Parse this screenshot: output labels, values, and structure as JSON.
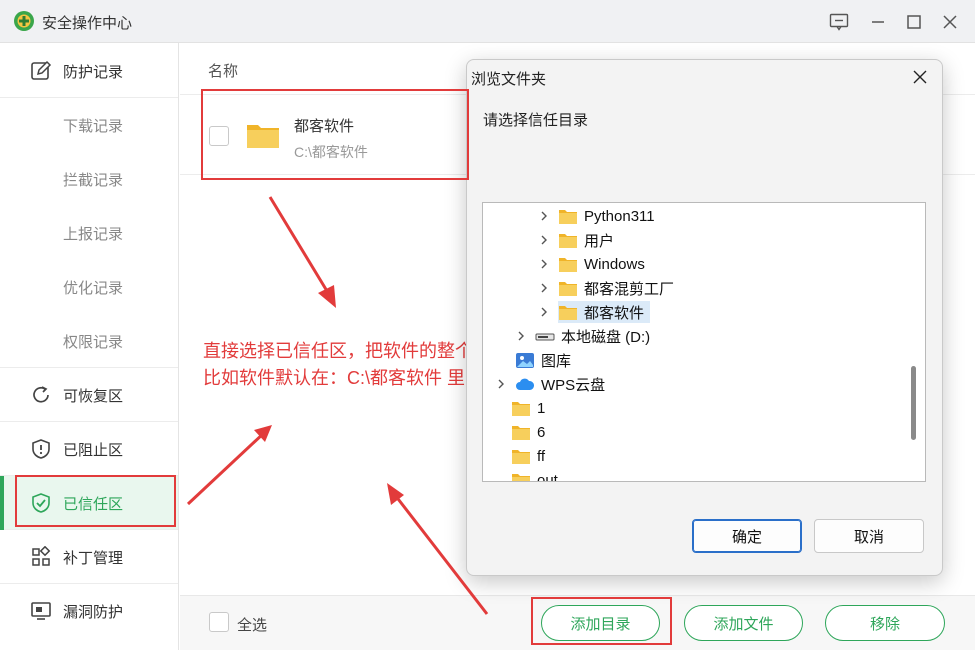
{
  "app": {
    "title": "安全操作中心"
  },
  "sidebar": {
    "items": [
      {
        "label": "防护记录",
        "icon": "edit-icon",
        "type": "main"
      },
      {
        "label": "下载记录",
        "type": "sub"
      },
      {
        "label": "拦截记录",
        "type": "sub"
      },
      {
        "label": "上报记录",
        "type": "sub"
      },
      {
        "label": "优化记录",
        "type": "sub"
      },
      {
        "label": "权限记录",
        "type": "sub"
      },
      {
        "label": "可恢复区",
        "icon": "restore-icon",
        "type": "main"
      },
      {
        "label": "已阻止区",
        "icon": "shield-alert-icon",
        "type": "main"
      },
      {
        "label": "已信任区",
        "icon": "shield-check-icon",
        "type": "main",
        "active": true
      },
      {
        "label": "补丁管理",
        "icon": "grid-icon",
        "type": "main"
      },
      {
        "label": "漏洞防护",
        "icon": "monitor-icon",
        "type": "main"
      }
    ]
  },
  "main": {
    "column_header": "名称",
    "rows": [
      {
        "name": "都客软件",
        "path": "C:\\都客软件"
      }
    ]
  },
  "footer": {
    "select_all": "全选",
    "add_dir": "添加目录",
    "add_file": "添加文件",
    "remove": "移除"
  },
  "annotation": {
    "line1": "直接选择已信任区，把软件的整个目录添加进去。",
    "line2": "比如软件默认在：C:\\都客软件 里面"
  },
  "dialog": {
    "title": "浏览文件夹",
    "prompt": "请选择信任目录",
    "tree": [
      {
        "label": "Python311",
        "icon": "folder-icon",
        "expandable": true
      },
      {
        "label": "用户",
        "icon": "folder-icon",
        "expandable": true
      },
      {
        "label": "Windows",
        "icon": "folder-icon",
        "expandable": true
      },
      {
        "label": "都客混剪工厂",
        "icon": "folder-icon",
        "expandable": true
      },
      {
        "label": "都客软件",
        "icon": "folder-icon",
        "expandable": true,
        "selected": true
      },
      {
        "label": "本地磁盘 (D:)",
        "icon": "drive-icon",
        "expandable": true
      },
      {
        "label": "图库",
        "icon": "gallery-icon",
        "expandable": false
      },
      {
        "label": "WPS云盘",
        "icon": "cloud-icon",
        "expandable": true
      },
      {
        "label": "1",
        "icon": "folder-icon",
        "expandable": false
      },
      {
        "label": "6",
        "icon": "folder-icon",
        "expandable": false
      },
      {
        "label": "ff",
        "icon": "folder-icon",
        "expandable": false
      },
      {
        "label": "out",
        "icon": "folder-icon",
        "expandable": false
      }
    ],
    "ok": "确定",
    "cancel": "取消"
  },
  "colors": {
    "accent": "#2ea65a",
    "annotation": "#e23b3b",
    "selection": "#dbeaf8",
    "folder": "#f5c542"
  }
}
